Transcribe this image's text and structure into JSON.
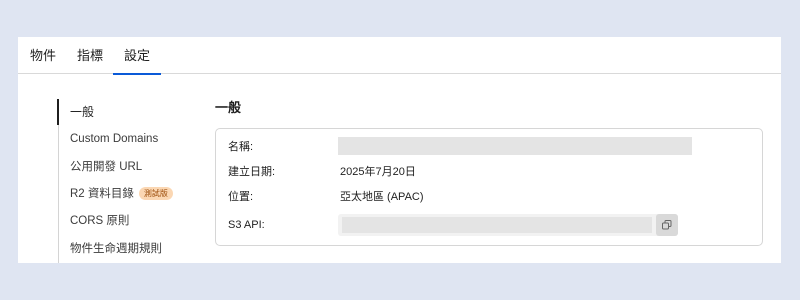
{
  "tabs": [
    "物件",
    "指標",
    "設定"
  ],
  "active_tab": "設定",
  "sidebar": {
    "items": [
      {
        "label": "一般"
      },
      {
        "label": "Custom Domains"
      },
      {
        "label": "公用開發 URL"
      },
      {
        "label": "R2 資料目錄",
        "badge": "測試版"
      },
      {
        "label": "CORS 原則"
      },
      {
        "label": "物件生命週期規則"
      }
    ]
  },
  "section": {
    "title": "一般",
    "fields": {
      "name_label": "名稱:",
      "created_label": "建立日期:",
      "created_value": "2025年7月20日",
      "location_label": "位置:",
      "location_value": "亞太地區 (APAC)",
      "s3_label": "S3 API:"
    }
  },
  "icons": {
    "copy": "copy-icon"
  },
  "colors": {
    "accent": "#0a5ad8",
    "badge_bg": "#fbd7b3",
    "background": "#dfe5f2"
  }
}
